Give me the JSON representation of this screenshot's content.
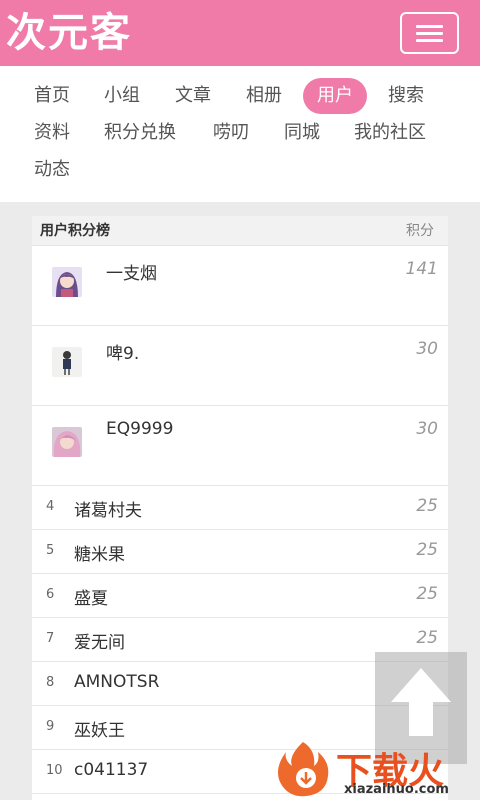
{
  "header": {
    "logo_text": "次元客",
    "menu_icon": "hamburger-menu-icon",
    "colors": {
      "brand": "#f07aa8"
    }
  },
  "nav": {
    "items": [
      {
        "label": "首页"
      },
      {
        "label": "小组"
      },
      {
        "label": "文章"
      },
      {
        "label": "相册"
      },
      {
        "label": "用户",
        "active": true
      },
      {
        "label": "搜索"
      },
      {
        "label": "资料"
      },
      {
        "label": "积分兑换"
      },
      {
        "label": "唠叨"
      },
      {
        "label": "同城"
      },
      {
        "label": "我的社区"
      },
      {
        "label": "动态"
      }
    ]
  },
  "leaderboard": {
    "title": "用户积分榜",
    "score_header": "积分",
    "top": [
      {
        "name": "一支烟",
        "score": "141",
        "avatar": "anime-girl-avatar"
      },
      {
        "name": "啤9.",
        "score": "30",
        "avatar": "standing-figure-avatar"
      },
      {
        "name": "EQ9999",
        "score": "30",
        "avatar": "pink-hair-avatar"
      }
    ],
    "rest": [
      {
        "rank": "4",
        "name": "诸葛村夫",
        "score": "25"
      },
      {
        "rank": "5",
        "name": "糖米果",
        "score": "25"
      },
      {
        "rank": "6",
        "name": "盛夏",
        "score": "25"
      },
      {
        "rank": "7",
        "name": "爱无间",
        "score": "25"
      },
      {
        "rank": "8",
        "name": "AMNOTSR",
        "score": ""
      },
      {
        "rank": "9",
        "name": "巫妖王",
        "score": ""
      },
      {
        "rank": "10",
        "name": "c041137",
        "score": ""
      }
    ]
  },
  "back_to_top": {
    "icon": "arrow-up-icon"
  },
  "watermark": {
    "text": "下载火",
    "url": "xiazaihuo.com",
    "icon": "flame-logo-icon"
  }
}
